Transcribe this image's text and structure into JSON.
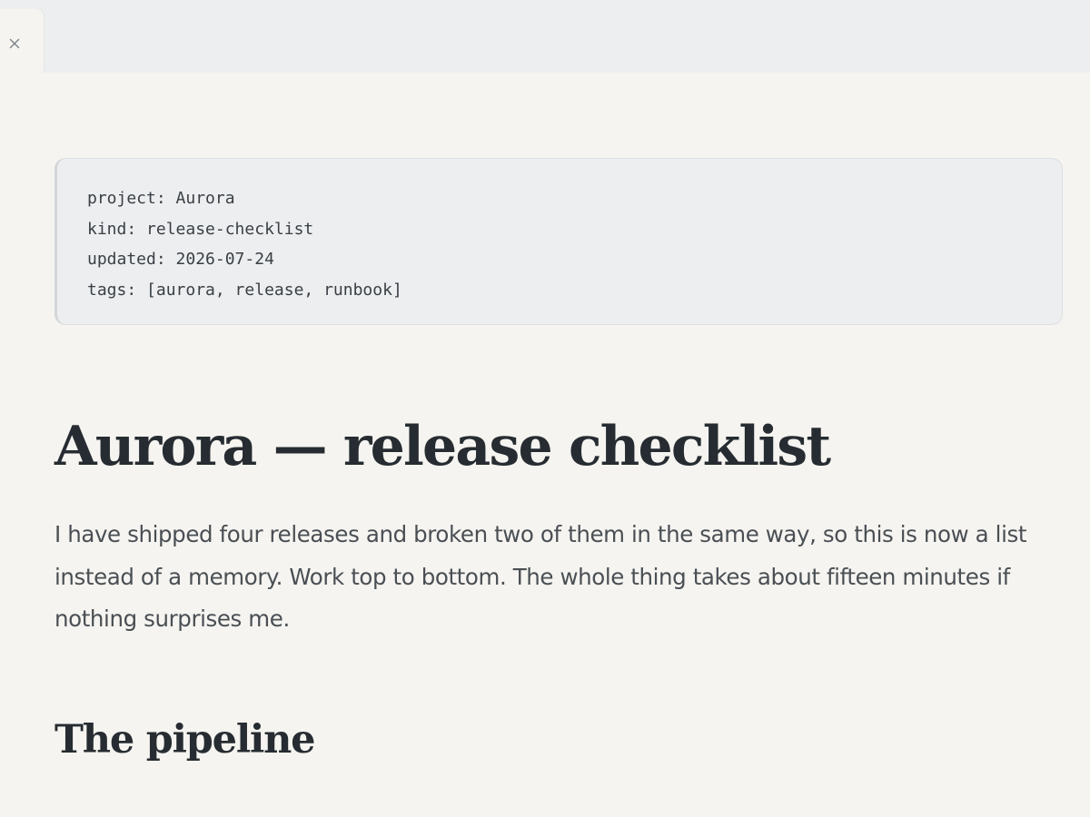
{
  "tab": {
    "close_icon": "close-icon"
  },
  "frontmatter": {
    "lines": [
      "project: Aurora",
      "kind: release-checklist",
      "updated: 2026-07-24",
      "tags: [aurora, release, runbook]"
    ]
  },
  "document": {
    "title": "Aurora — release checklist",
    "intro": "I have shipped four releases and broken two of them in the same way, so this is now a list instead of a memory. Work top to bottom. The whole thing takes about fifteen minutes if nothing surprises me.",
    "section_heading": "The pipeline"
  },
  "colors": {
    "background": "#f5f4f0",
    "tabstrip": "#eceef0",
    "heading_text": "#262c31",
    "body_text": "#4a4f54"
  }
}
